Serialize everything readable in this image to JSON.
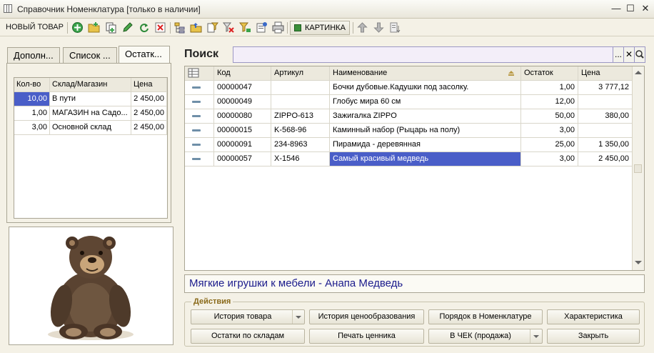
{
  "window": {
    "title": "Справочник Номенклатура [только в наличии]",
    "minimize": "—",
    "maximize": "☐",
    "close": "✕"
  },
  "toolbar": {
    "new_item_label": "НОВЫЙ ТОВАР",
    "picture_label": "КАРТИНКА"
  },
  "tabs": [
    "Дополн...",
    "Список ...",
    "Остатк..."
  ],
  "stock": {
    "headers": [
      "Кол-во",
      "Склад/Магазин",
      "Цена"
    ],
    "rows": [
      {
        "qty": "10,00",
        "store": "В пути",
        "price": "2 450,00"
      },
      {
        "qty": "1,00",
        "store": "МАГАЗИН на Садо...",
        "price": "2 450,00"
      },
      {
        "qty": "3,00",
        "store": "Основной склад",
        "price": "2 450,00"
      }
    ]
  },
  "search": {
    "label": "Поиск",
    "value": "",
    "more_btn": "...",
    "clear_btn": "✕"
  },
  "grid": {
    "headers": {
      "code": "Код",
      "article": "Артикул",
      "name": "Наименование",
      "stock": "Остаток",
      "price": "Цена"
    },
    "rows": [
      {
        "code": "00000047",
        "article": "",
        "name": "Бочки дубовые.Кадушки под засолку.",
        "stock": "1,00",
        "price": "3 777,12"
      },
      {
        "code": "00000049",
        "article": "",
        "name": "Глобус мира 60 см",
        "stock": "12,00",
        "price": ""
      },
      {
        "code": "00000080",
        "article": "ZIPPO-613",
        "name": "Зажигалка ZIPPO",
        "stock": "50,00",
        "price": "380,00"
      },
      {
        "code": "00000015",
        "article": "K-568-96",
        "name": "Каминный набор (Рыцарь на полу)",
        "stock": "3,00",
        "price": ""
      },
      {
        "code": "00000091",
        "article": "234-8963",
        "name": "Пирамида - деревянная",
        "stock": "25,00",
        "price": "1 350,00"
      },
      {
        "code": "00000057",
        "article": "X-1546",
        "name": "Самый красивый медведь",
        "stock": "3,00",
        "price": "2 450,00"
      }
    ]
  },
  "description": "Мягкие игрушки к мебели - Анапа Медведь",
  "actions": {
    "label": "Действия",
    "history": "История товара",
    "price_history": "История ценообразования",
    "order": "Порядок в Номенклатуре",
    "characteristics": "Характеристика",
    "stock_by_store": "Остатки по складам",
    "print_label": "Печать ценника",
    "to_receipt": "В ЧЕК (продажа)",
    "close": "Закрыть"
  }
}
